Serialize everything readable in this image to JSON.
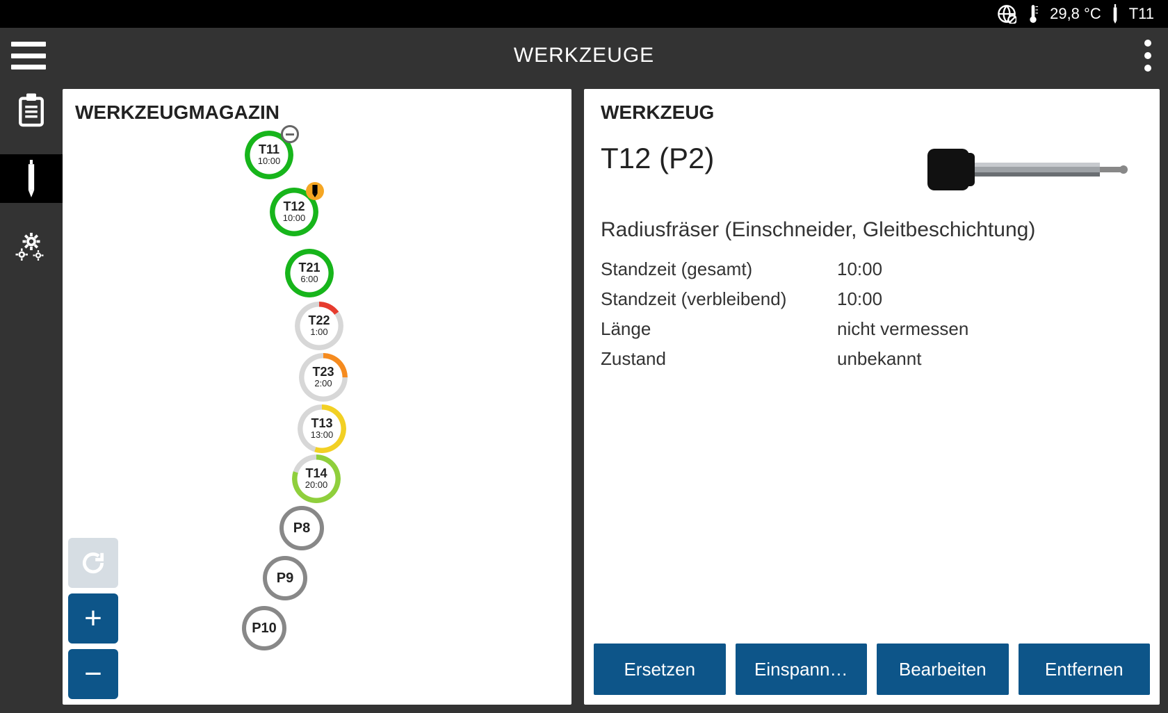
{
  "statusbar": {
    "temperature": "29,8 °C",
    "active_tool": "T11"
  },
  "titlebar": {
    "title": "WERKZEUGE"
  },
  "sidebar": {
    "items": [
      "clipboard",
      "tool",
      "settings"
    ]
  },
  "magazine": {
    "title": "WERKZEUGMAGAZIN",
    "slots": [
      {
        "id": "T11",
        "time": "10:00",
        "ring_color": "#17b51b",
        "ring_pct": 100,
        "badge": "minus",
        "selected": false
      },
      {
        "id": "T12",
        "time": "10:00",
        "ring_color": "#17b51b",
        "ring_pct": 100,
        "badge": "tool-warn",
        "selected": true
      },
      {
        "id": "T21",
        "time": "6:00",
        "ring_color": "#17b51b",
        "ring_pct": 100,
        "badge": null,
        "selected": false
      },
      {
        "id": "T22",
        "time": "1:00",
        "ring_color": "#e63b2e",
        "ring_pct": 15,
        "badge": null,
        "selected": false
      },
      {
        "id": "T23",
        "time": "2:00",
        "ring_color": "#f58b1f",
        "ring_pct": 25,
        "badge": null,
        "selected": false
      },
      {
        "id": "T13",
        "time": "13:00",
        "ring_color": "#f2d024",
        "ring_pct": 55,
        "badge": null,
        "selected": false
      },
      {
        "id": "T14",
        "time": "20:00",
        "ring_color": "#8fcf3c",
        "ring_pct": 80,
        "badge": null,
        "selected": false
      },
      {
        "id": "P8",
        "time": null,
        "empty": true
      },
      {
        "id": "P9",
        "time": null,
        "empty": true
      },
      {
        "id": "P10",
        "time": null,
        "empty": true
      }
    ],
    "zoom": {
      "reset_enabled": false
    }
  },
  "detail": {
    "title": "WERKZEUG",
    "tool_name": "T12 (P2)",
    "description": "Radiusfräser (Einschneider, Gleitbeschichtung)",
    "props": {
      "standzeit_gesamt_label": "Standzeit (gesamt)",
      "standzeit_gesamt_value": "10:00",
      "standzeit_verbleibend_label": "Standzeit (verbleibend)",
      "standzeit_verbleibend_value": "10:00",
      "laenge_label": "Länge",
      "laenge_value": "nicht vermessen",
      "zustand_label": "Zustand",
      "zustand_value": "unbekannt"
    },
    "actions": {
      "ersetzen": "Ersetzen",
      "einspannen": "Einspann…",
      "bearbeiten": "Bearbeiten",
      "entfernen": "Entfernen"
    }
  }
}
